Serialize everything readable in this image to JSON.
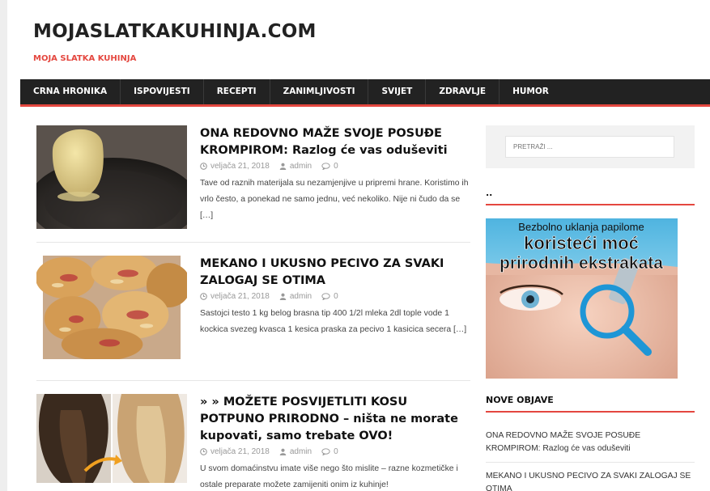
{
  "site": {
    "title": "MOJASLATKAKUHINJA.COM",
    "tagline": "MOJA SLATKA KUHINJA",
    "accent_color": "#e4473f",
    "nav_bg": "#222222"
  },
  "nav": {
    "items": [
      "CRNA HRONIKA",
      "ISPOVIJESTI",
      "RECEPTI",
      "ZANIMLJIVOSTI",
      "SVIJET",
      "ZDRAVLJE",
      "HUMOR"
    ]
  },
  "posts": [
    {
      "title": "ONA REDOVNO MAŽE SVOJE POSUĐE KROMPIROM: Razlog će vas oduševiti",
      "date": "veljača 21, 2018",
      "author": "admin",
      "comments": "0",
      "excerpt": "Tave od raznih materijala su nezamjenjive u pripremi hrane. Koristimo ih vrlo često, a ponekad ne samo jednu, već nekoliko. Nije ni čudo da se",
      "more": "[…]",
      "thumb_icon": "potato-pan-image"
    },
    {
      "title": "MEKANO I UKUSNO PECIVO ZA SVAKI ZALOGAJ SE OTIMA",
      "date": "veljača 21, 2018",
      "author": "admin",
      "comments": "0",
      "excerpt": "Sastojci testo 1 kg belog brasna tip 400 1/2l mleka 2dl tople vode 1 kockica svezeg kvasca 1 kesica praska za pecivo 1 kasicica secera",
      "more": "[…]",
      "thumb_icon": "pastry-image"
    },
    {
      "title": "» » MOŽETE POSVIJETLITI KOSU POTPUNO PRIRODNO – ništa ne morate kupovati, samo trebate OVO!",
      "date": "veljača 21, 2018",
      "author": "admin",
      "comments": "0",
      "excerpt": "U svom domaćinstvu imate više nego što mislite – razne kozmetičke i ostale preparate možete zamijeniti onim iz kuhinje!",
      "more": "",
      "thumb_icon": "hair-before-after-image"
    }
  ],
  "sidebar": {
    "search_placeholder": "PRETRAŽI ...",
    "widget1_title": "..",
    "ad": {
      "line1": "Bezbolno uklanja papilome",
      "line2": "koristeći moć",
      "line3": "prirodnih ekstrakata"
    },
    "recent_title": "NOVE OBJAVE",
    "recent": [
      "ONA REDOVNO MAŽE SVOJE POSUĐE KROMPIROM: Razlog će vas oduševiti",
      "MEKANO I UKUSNO PECIVO ZA SVAKI ZALOGAJ SE OTIMA"
    ]
  },
  "icons": {
    "date": "clock-icon",
    "author": "user-icon",
    "comments": "comment-icon"
  }
}
